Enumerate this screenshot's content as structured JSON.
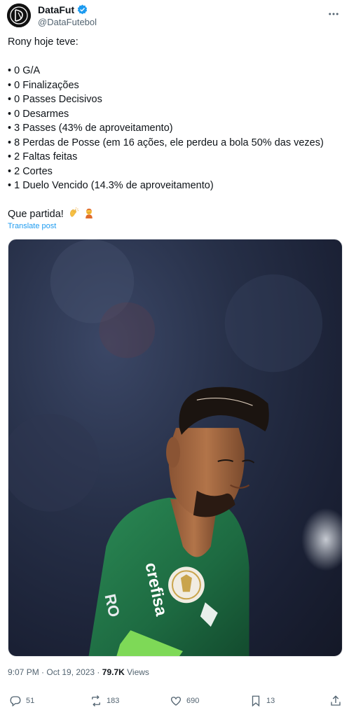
{
  "author": {
    "display_name": "DataFut",
    "handle": "@DataFutebol",
    "verified": true,
    "avatar_icon": "datafut-logo",
    "more_icon": "more-dots-icon"
  },
  "post": {
    "lines": [
      "Rony hoje teve:",
      "",
      "• 0 G/A",
      "• 0 Finalizações",
      "• 0 Passes Decisivos",
      "• 0 Desarmes",
      "• 3 Passes (43% de aproveitamento)",
      "• 8 Perdas de Posse (em 16 ações, ele perdeu a bola 50% das vezes)",
      "• 2 Faltas feitas",
      "• 2 Cortes",
      "• 1 Duelo Vencido (14.3% de aproveitamento)",
      "",
      "Que partida!"
    ],
    "emojis": [
      "clapping-hands-emoji",
      "person-facepalming-emoji"
    ],
    "translate_label": "Translate post"
  },
  "media": {
    "icon": "player-photo",
    "shirt_text": "crefisa",
    "back_text": "RO"
  },
  "meta": {
    "time": "9:07 PM",
    "separator": " · ",
    "date": "Oct 19, 2023",
    "views_count": "79.7K",
    "views_label": " Views"
  },
  "actions": {
    "reply": {
      "icon": "reply-icon",
      "count": "51"
    },
    "repost": {
      "icon": "repost-icon",
      "count": "183"
    },
    "like": {
      "icon": "heart-icon",
      "count": "690"
    },
    "bookmark": {
      "icon": "bookmark-icon",
      "count": "13"
    },
    "share": {
      "icon": "share-icon"
    }
  },
  "colors": {
    "accent": "#1d9bf0",
    "text": "#0f1419",
    "muted": "#536471",
    "shirt_green": "#1f6b45"
  }
}
